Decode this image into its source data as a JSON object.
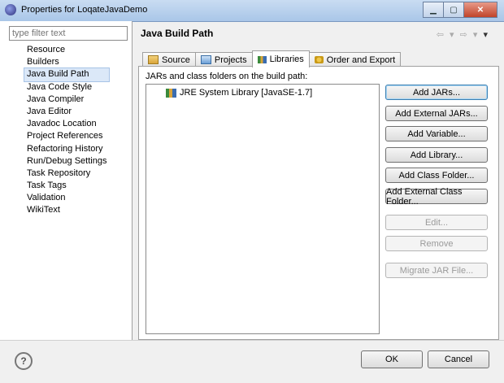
{
  "window": {
    "title": "Properties for LoqateJavaDemo"
  },
  "filter": {
    "placeholder": "type filter text"
  },
  "tree": {
    "items": [
      "Resource",
      "Builders",
      "Java Build Path",
      "Java Code Style",
      "Java Compiler",
      "Java Editor",
      "Javadoc Location",
      "Project References",
      "Refactoring History",
      "Run/Debug Settings",
      "Task Repository",
      "Task Tags",
      "Validation",
      "WikiText"
    ],
    "selected": "Java Build Path"
  },
  "page": {
    "title": "Java Build Path"
  },
  "tabs": [
    {
      "label": "Source",
      "icon": "source-folder-icon"
    },
    {
      "label": "Projects",
      "icon": "projects-icon"
    },
    {
      "label": "Libraries",
      "icon": "libraries-icon",
      "active": true
    },
    {
      "label": "Order and Export",
      "icon": "order-export-icon"
    }
  ],
  "libraries": {
    "label": "JARs and class folders on the build path:",
    "entries": [
      "JRE System Library [JavaSE-1.7]"
    ],
    "buttons": {
      "add_jars": "Add JARs...",
      "add_external_jars": "Add External JARs...",
      "add_variable": "Add Variable...",
      "add_library": "Add Library...",
      "add_class_folder": "Add Class Folder...",
      "add_external_class_folder": "Add External Class Folder...",
      "edit": "Edit...",
      "remove": "Remove",
      "migrate_jar": "Migrate JAR File..."
    }
  },
  "footer": {
    "ok": "OK",
    "cancel": "Cancel",
    "help": "?"
  }
}
